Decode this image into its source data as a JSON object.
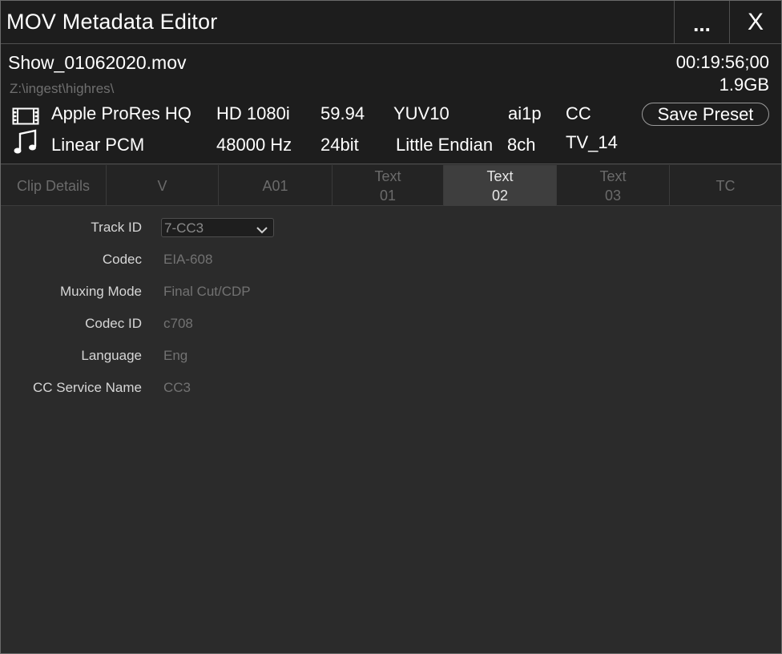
{
  "window": {
    "title": "MOV Metadata Editor",
    "more_label": "...",
    "close_label": "X"
  },
  "file": {
    "name": "Show_01062020.mov",
    "path": "Z:\\ingest\\highres\\",
    "duration": "00:19:56;00",
    "size": "1.9GB"
  },
  "video": {
    "icon": "film-icon",
    "codec": "Apple ProRes HQ",
    "format": "HD 1080i",
    "fps": "59.94",
    "color": "YUV10",
    "tag": "ai1p",
    "cc": "CC"
  },
  "audio": {
    "icon": "music-note-icon",
    "codec": "Linear PCM",
    "rate": "48000 Hz",
    "depth": "24bit",
    "endian": "Little Endian",
    "channels": "8ch",
    "rating": "TV_14"
  },
  "save_preset_label": "Save Preset",
  "tabs": [
    {
      "line1": "Clip Details",
      "line2": ""
    },
    {
      "line1": "V",
      "line2": ""
    },
    {
      "line1": "A01",
      "line2": ""
    },
    {
      "line1": "Text",
      "line2": "01"
    },
    {
      "line1": "Text",
      "line2": "02"
    },
    {
      "line1": "Text",
      "line2": "03"
    },
    {
      "line1": "TC",
      "line2": ""
    }
  ],
  "active_tab": "Text 02",
  "fields": {
    "track_id": {
      "label": "Track ID",
      "value": "7-CC3"
    },
    "codec": {
      "label": "Codec",
      "value": "EIA-608"
    },
    "muxing_mode": {
      "label": "Muxing Mode",
      "value": "Final Cut/CDP"
    },
    "codec_id": {
      "label": "Codec ID",
      "value": "c708"
    },
    "language": {
      "label": "Language",
      "value": "Eng"
    },
    "cc_service_name": {
      "label": "CC Service Name",
      "value": "CC3"
    }
  },
  "colors": {
    "background": "#2b2b2b",
    "header": "#1d1d1d",
    "active_tab": "#3e3e3e",
    "dim_text": "#727272"
  }
}
